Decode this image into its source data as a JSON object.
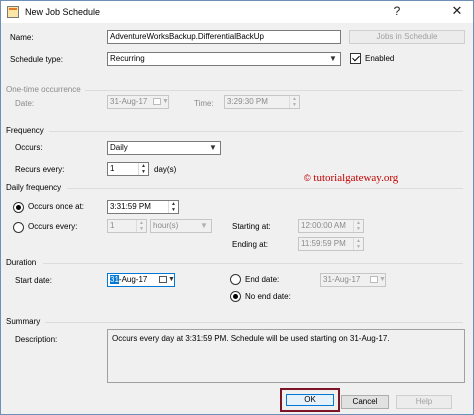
{
  "window": {
    "title": "New Job Schedule",
    "help_glyph": "?",
    "close_glyph": "✕"
  },
  "form": {
    "name_label": "Name:",
    "name_value": "AdventureWorksBackup.DifferentialBackUp",
    "jobs_in_schedule_label": "Jobs in Schedule",
    "schedule_type_label": "Schedule type:",
    "schedule_type_value": "Recurring",
    "enabled_label": "Enabled",
    "enabled_checked": true
  },
  "one_time": {
    "section_label": "One-time occurrence",
    "date_label": "Date:",
    "date_value": "31-Aug-17",
    "time_label": "Time:",
    "time_value": "3:29:30 PM"
  },
  "frequency": {
    "section_label": "Frequency",
    "occurs_label": "Occurs:",
    "occurs_value": "Daily",
    "recurs_label": "Recurs every:",
    "recurs_value": "1",
    "recurs_unit": "day(s)"
  },
  "daily_frequency": {
    "section_label": "Daily frequency",
    "once_label": "Occurs once at:",
    "once_value": "3:31:59 PM",
    "every_label": "Occurs every:",
    "every_value": "1",
    "every_unit": "hour(s)",
    "starting_label": "Starting at:",
    "starting_value": "12:00:00 AM",
    "ending_label": "Ending at:",
    "ending_value": "11:59:59 PM",
    "selected": "once"
  },
  "duration": {
    "section_label": "Duration",
    "start_label": "Start date:",
    "start_day": "31",
    "start_rest": "-Aug-17",
    "end_label": "End date:",
    "end_value": "31-Aug-17",
    "no_end_label": "No end date:",
    "selected": "no_end"
  },
  "summary": {
    "section_label": "Summary",
    "description_label": "Description:",
    "description_text": "Occurs every day at 3:31:59 PM. Schedule will be used starting on 31-Aug-17."
  },
  "buttons": {
    "ok": "OK",
    "cancel": "Cancel",
    "help": "Help"
  },
  "watermark": {
    "symbol": "©",
    "text": "tutorialgateway.org"
  },
  "glyphs": {
    "dropdown": "▼",
    "spin_up": "▲",
    "spin_down": "▼"
  },
  "colors": {
    "ok_highlight": "#7b1425",
    "watermark": "#c00000",
    "selection": "#0078d7"
  }
}
